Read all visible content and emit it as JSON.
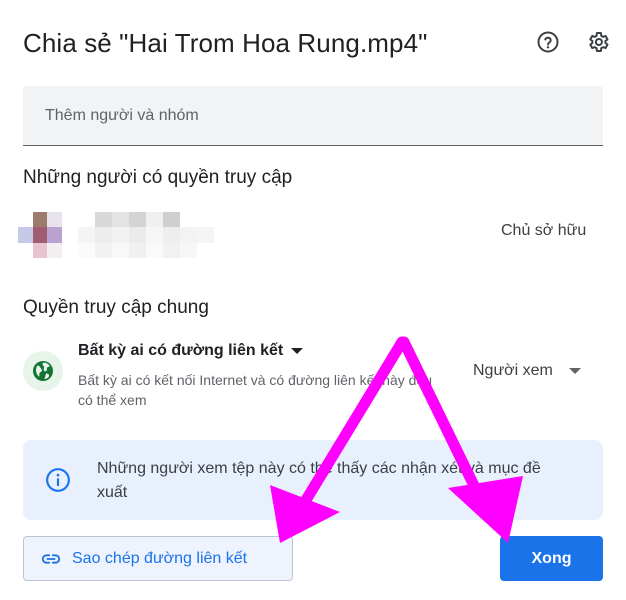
{
  "dialog": {
    "title": "Chia sẻ \"Hai Trom Hoa Rung.mp4\"",
    "help_icon": "help-circle-icon",
    "settings_icon": "gear-icon"
  },
  "add_people": {
    "placeholder": "Thêm người và nhóm"
  },
  "people_with_access": {
    "heading": "Những người có quyền truy cập",
    "user": {
      "role": "Chủ sở hữu"
    }
  },
  "general_access": {
    "heading": "Quyền truy cập chung",
    "scope_label": "Bất kỳ ai có đường liên kết",
    "scope_description": "Bất kỳ ai có kết nối Internet và có đường liên kết này đều có thể xem",
    "role_label": "Người xem"
  },
  "info": {
    "text": "Những người xem tệp này có thể thấy các nhận xét và mục đề xuất"
  },
  "footer": {
    "copy_link_label": "Sao chép đường liên kết",
    "done_label": "Xong"
  },
  "colors": {
    "accent": "#1a73e8",
    "annotation_arrow": "#ff00ff"
  }
}
